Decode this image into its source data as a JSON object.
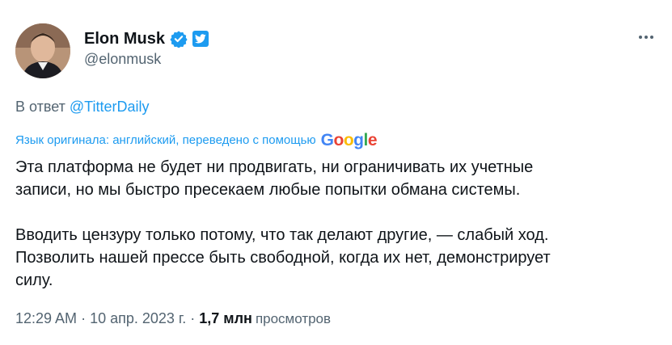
{
  "author": {
    "display_name": "Elon Musk",
    "handle": "@elonmusk",
    "verified_icon": "verified-badge-icon",
    "badge_icon": "twitter-bird-icon"
  },
  "reply": {
    "prefix": "В ответ",
    "target": "@TitterDaily"
  },
  "translation": {
    "note": "Язык оригинала: английский, переведено с помощью",
    "provider": "Google"
  },
  "tweet": {
    "paragraph_1": "Эта платформа не будет ни продвигать, ни ограничивать их учетные\nзаписи, но мы быстро пресекаем любые попытки обмана системы.",
    "paragraph_2": "Вводить цензуру только потому, что так делают другие, — слабый ход.\nПозволить нашей прессе быть свободной, когда их нет, демонстрирует\nсилу."
  },
  "meta": {
    "time": "12:29 AM",
    "date": "10 апр. 2023 г.",
    "views_count": "1,7 млн",
    "views_label": "просмотров"
  },
  "colors": {
    "accent": "#1d9bf0",
    "text": "#0f1419",
    "secondary": "#536471"
  }
}
